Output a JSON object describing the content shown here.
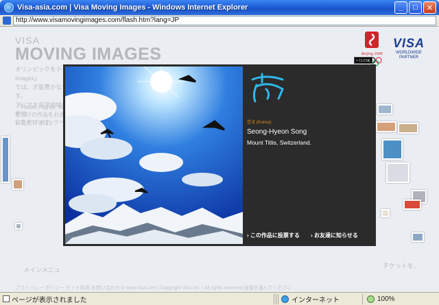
{
  "window": {
    "title": "Visa-asia.com | Visa Moving Images - Windows Internet Explorer",
    "minimize": "_",
    "maximize": "□",
    "close": "✕"
  },
  "address": {
    "url": "http://www.visamovingimages.com/flash.htm?lang=JP"
  },
  "page": {
    "visa_small": "VISA",
    "brand_title": "MOVING IMAGES",
    "desc_line1": "オリンピックをテーマとした唯一のフォト・コンテスト「Visa Moving Images」",
    "desc_line2": "では、才能豊かなアマチュア・カメラマンの方からの作品をお待ちしています。",
    "desc_line3": "アジア太平洋地域にお住まいのＶＩＳＡカード会員であれば、どなたでもご参加",
    "desc_line4": "いただけます。",
    "desc2_line1": "「Faster, Higher, Str",
    "desc2_line2": "ただけの作品をお送り",
    "desc2_line3": "北京オリンピックへ",
    "menu_item": "メインメニュ",
    "right_text": "チケットを、",
    "footer_text": "プライバシー  ポリシー  サイト利用  お問い合わせ   © www.visa.com | Copyright Visa Inc. | All rights reserved   画像を選んでください"
  },
  "sponsor": {
    "beijing": "Beijing 2008",
    "visa_word": "VISA",
    "visa_sub1": "WORLDWIDE",
    "visa_sub2": "PARTNER"
  },
  "lightbox": {
    "close_label": "× CLOSE",
    "country": "한국 (Korea)",
    "photographer": "Seong-Hyeon Song",
    "location": "Mount Titlis, Switzerland.",
    "vote_action": "› この作品に投票する",
    "share_action": "› お友達に知らせる"
  },
  "status": {
    "text": "ページが表示されました",
    "zone": "インターネット",
    "zoom": "100%"
  },
  "colors": {
    "title_bar": "#1f5fd6",
    "lightbox_bg": "#2b2b2b",
    "country_accent": "#e58a18",
    "calligraphy": "#2fb8ea"
  }
}
